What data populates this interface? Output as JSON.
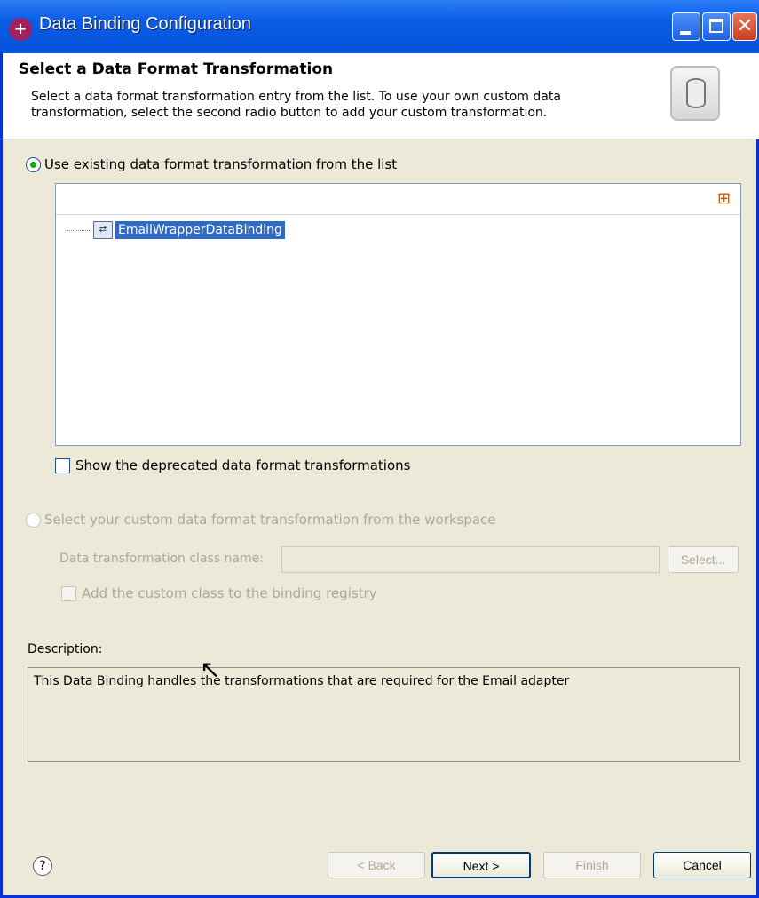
{
  "window": {
    "title": "Data Binding Configuration"
  },
  "header": {
    "title": "Select a Data Format Transformation",
    "description_line1": "Select a data format transformation entry from the list.  To use your own custom data",
    "description_line2": "transformation, select the second radio button to add your custom transformation."
  },
  "existing": {
    "radio_label": "Use existing data format transformation from the list",
    "selected": true,
    "list_items": [
      {
        "label": "EmailWrapperDataBinding",
        "selected": true
      }
    ],
    "show_deprecated_label": "Show the deprecated data format transformations",
    "show_deprecated_checked": false
  },
  "custom": {
    "radio_label": "Select your custom data format transformation from the workspace",
    "enabled": false,
    "class_name_label": "Data transformation class name:",
    "class_name_value": "",
    "select_button": "Select...",
    "registry_checkbox_label": "Add the custom class to the binding registry"
  },
  "description": {
    "label": "Description:",
    "text": "This Data Binding handles the transformations that are required for the Email adapter"
  },
  "buttons": {
    "help": "?",
    "back": "< Back",
    "next": "Next >",
    "finish": "Finish",
    "cancel": "Cancel"
  },
  "colors": {
    "title_bar": "#0a5ce6",
    "selection": "#316ac5",
    "dialog_bg": "#ece9d8"
  },
  "icons": {
    "title": "eclipse-icon",
    "minimize": "minimize-icon",
    "maximize": "maximize-icon",
    "close": "close-icon",
    "header": "database-cylinder-icon",
    "toolbar": "grid-icon",
    "item": "data-binding-icon",
    "help": "help-icon"
  }
}
